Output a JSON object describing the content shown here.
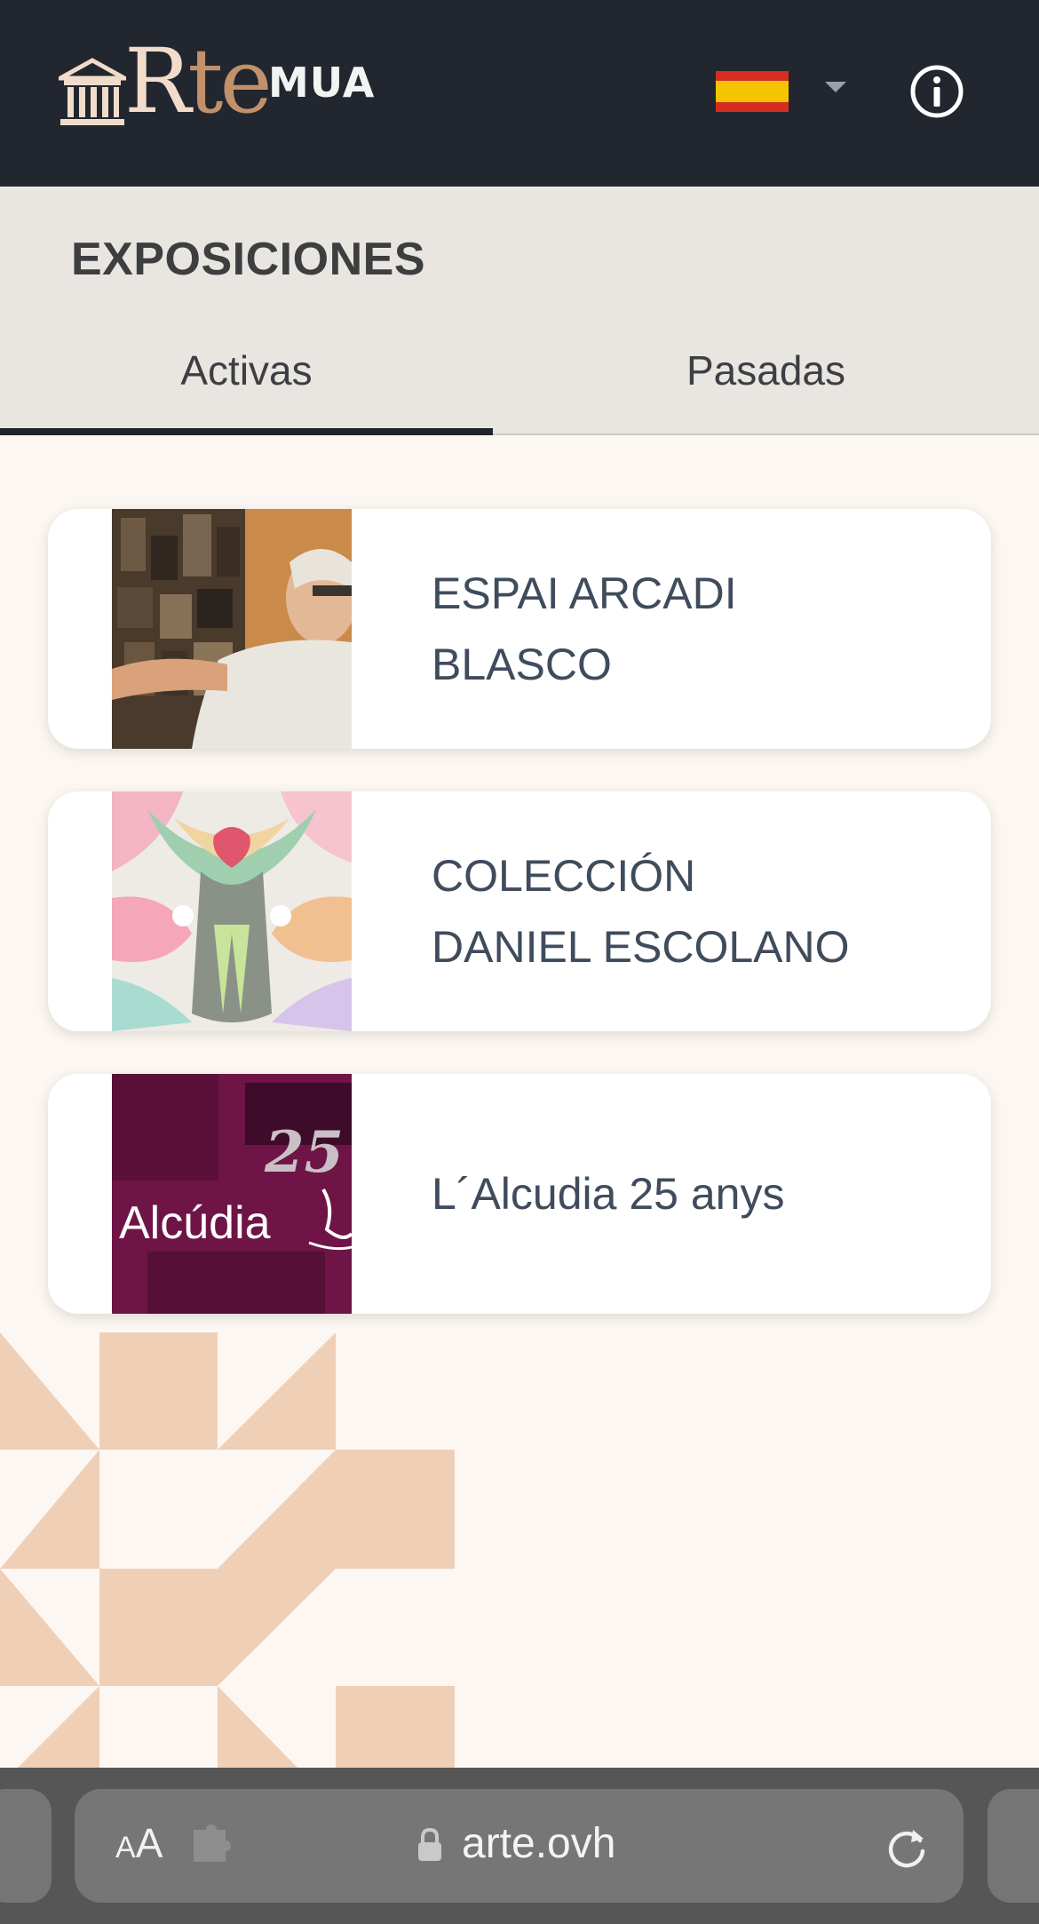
{
  "header": {
    "logo": {
      "text_r": "R",
      "text_te": "te",
      "mua": "MUA",
      "icon": "museum-temple-icon"
    },
    "language": {
      "selected": "es",
      "flag_icon": "spain-flag-icon",
      "caret_icon": "chevron-down-icon"
    },
    "info_icon": "info-icon"
  },
  "page": {
    "title": "EXPOSICIONES",
    "tabs": [
      {
        "label": "Activas",
        "active": true
      },
      {
        "label": "Pasadas",
        "active": false
      }
    ]
  },
  "exhibitions": [
    {
      "title": "ESPAI ARCADI\nBLASCO",
      "thumbnail": "artist-painting-photo"
    },
    {
      "title": "COLECCIÓN\nDANIEL ESCOLANO",
      "thumbnail": "colorful-abstract-artwork"
    },
    {
      "title": "L´Alcudia 25 anys",
      "thumbnail": "alcudia-25-poster",
      "thumb_text": "Alcúdia",
      "thumb_badge": "25"
    }
  ],
  "browser": {
    "text_size_label_small": "A",
    "text_size_label_large": "A",
    "url": "arte.ovh",
    "lock_icon": "lock-icon",
    "extension_icon": "puzzle-icon",
    "reload_icon": "reload-icon"
  },
  "colors": {
    "header_bg": "#22262e",
    "band_bg": "#e9e6e1",
    "page_bg": "#fcf7f2",
    "pattern": "#f0cfb7",
    "card_title": "#3f4c5c",
    "logo_light": "#f1dccb",
    "logo_copper": "#c2906a"
  }
}
